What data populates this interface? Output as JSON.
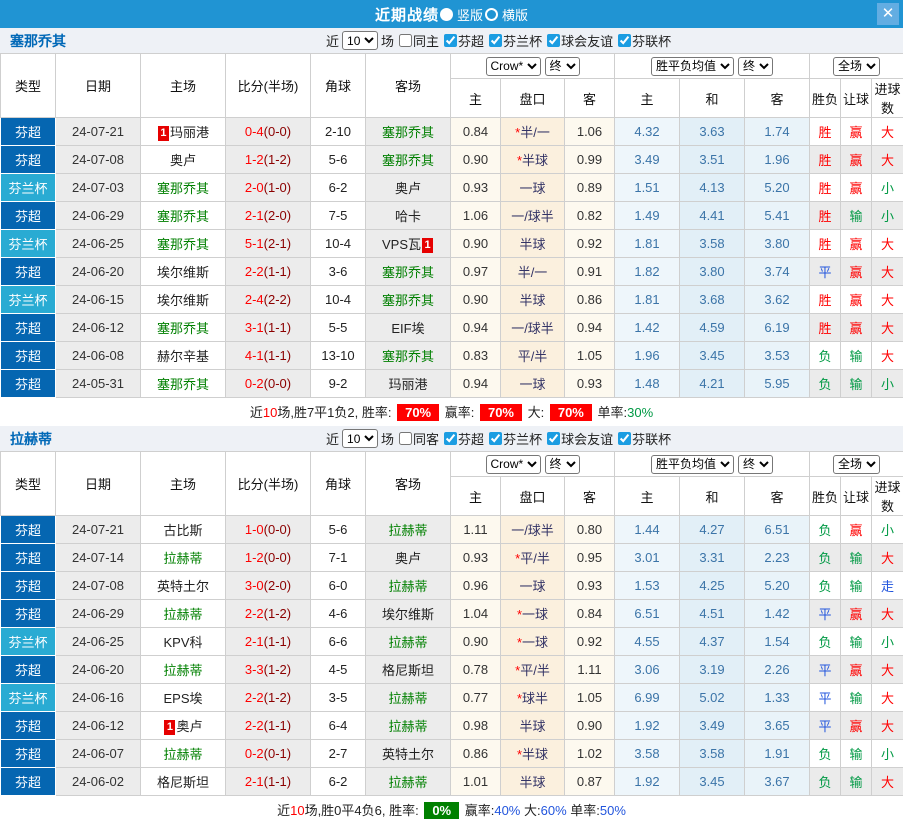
{
  "titlebar": {
    "title": "近期战绩",
    "vertical_label": "竖版",
    "horizontal_label": "横版",
    "close_label": "✕",
    "bar_color": "#2094d3"
  },
  "table_header": {
    "static_cols": [
      "类型",
      "日期",
      "主场",
      "比分(半场)",
      "角球",
      "客场"
    ],
    "sub_cols": [
      "主",
      "盘口",
      "客",
      "主",
      "和",
      "客",
      "胜负",
      "让球",
      "进球数"
    ],
    "selects": {
      "company": "Crow*",
      "company_final": "终",
      "avg": "胜平负均值",
      "avg_final": "终",
      "scope": "全场"
    }
  },
  "strings": {
    "card_label": "1"
  },
  "colors": {
    "league_super": "#0566b1",
    "league_cup": "#29abd3",
    "win": "#e60000",
    "draw": "#0000dd",
    "lose": "#008000"
  },
  "sections": [
    {
      "team": "塞那乔其",
      "filter": {
        "near": "近",
        "count": "10",
        "games": "场",
        "same": "同主",
        "leagues": [
          "芬超",
          "芬兰杯",
          "球会友谊",
          "芬联杯"
        ]
      },
      "rows": [
        {
          "type": "芬超",
          "cup": false,
          "date": "24-07-21",
          "home": {
            "name": "玛丽港",
            "green": false,
            "card": "before"
          },
          "score": "0-4",
          "half": "(0-0)",
          "corner": "2-10",
          "away": {
            "name": "塞那乔其",
            "green": true
          },
          "odds": [
            "0.84",
            "*半/一",
            "1.06"
          ],
          "avg": [
            "4.32",
            "3.63",
            "1.74"
          ],
          "res": [
            "胜",
            "赢",
            "大"
          ]
        },
        {
          "type": "芬超",
          "cup": false,
          "date": "24-07-08",
          "home": {
            "name": "奥卢",
            "green": false
          },
          "score": "1-2",
          "half": "(1-2)",
          "corner": "5-6",
          "away": {
            "name": "塞那乔其",
            "green": true
          },
          "odds": [
            "0.90",
            "*半球",
            "0.99"
          ],
          "avg": [
            "3.49",
            "3.51",
            "1.96"
          ],
          "res": [
            "胜",
            "赢",
            "大"
          ]
        },
        {
          "type": "芬兰杯",
          "cup": true,
          "date": "24-07-03",
          "home": {
            "name": "塞那乔其",
            "green": true
          },
          "score": "2-0",
          "half": "(1-0)",
          "corner": "6-2",
          "away": {
            "name": "奥卢",
            "green": false
          },
          "odds": [
            "0.93",
            "一球",
            "0.89"
          ],
          "avg": [
            "1.51",
            "4.13",
            "5.20"
          ],
          "res": [
            "胜",
            "赢",
            "小"
          ]
        },
        {
          "type": "芬超",
          "cup": false,
          "date": "24-06-29",
          "home": {
            "name": "塞那乔其",
            "green": true
          },
          "score": "2-1",
          "half": "(2-0)",
          "corner": "7-5",
          "away": {
            "name": "哈卡",
            "green": false
          },
          "odds": [
            "1.06",
            "一/球半",
            "0.82"
          ],
          "avg": [
            "1.49",
            "4.41",
            "5.41"
          ],
          "res": [
            "胜",
            "输",
            "小"
          ]
        },
        {
          "type": "芬兰杯",
          "cup": true,
          "date": "24-06-25",
          "home": {
            "name": "塞那乔其",
            "green": true
          },
          "score": "5-1",
          "half": "(2-1)",
          "corner": "10-4",
          "away": {
            "name": "VPS瓦",
            "green": false,
            "card": "after"
          },
          "odds": [
            "0.90",
            "半球",
            "0.92"
          ],
          "avg": [
            "1.81",
            "3.58",
            "3.80"
          ],
          "res": [
            "胜",
            "赢",
            "大"
          ]
        },
        {
          "type": "芬超",
          "cup": false,
          "date": "24-06-20",
          "home": {
            "name": "埃尔维斯",
            "green": false
          },
          "score": "2-2",
          "half": "(1-1)",
          "corner": "3-6",
          "away": {
            "name": "塞那乔其",
            "green": true
          },
          "odds": [
            "0.97",
            "半/一",
            "0.91"
          ],
          "avg": [
            "1.82",
            "3.80",
            "3.74"
          ],
          "res": [
            "平",
            "赢",
            "大"
          ]
        },
        {
          "type": "芬兰杯",
          "cup": true,
          "date": "24-06-15",
          "home": {
            "name": "埃尔维斯",
            "green": false
          },
          "score": "2-4",
          "half": "(2-2)",
          "corner": "10-4",
          "away": {
            "name": "塞那乔其",
            "green": true
          },
          "odds": [
            "0.90",
            "半球",
            "0.86"
          ],
          "avg": [
            "1.81",
            "3.68",
            "3.62"
          ],
          "res": [
            "胜",
            "赢",
            "大"
          ]
        },
        {
          "type": "芬超",
          "cup": false,
          "date": "24-06-12",
          "home": {
            "name": "塞那乔其",
            "green": true
          },
          "score": "3-1",
          "half": "(1-1)",
          "corner": "5-5",
          "away": {
            "name": "EIF埃",
            "green": false
          },
          "odds": [
            "0.94",
            "一/球半",
            "0.94"
          ],
          "avg": [
            "1.42",
            "4.59",
            "6.19"
          ],
          "res": [
            "胜",
            "赢",
            "大"
          ]
        },
        {
          "type": "芬超",
          "cup": false,
          "date": "24-06-08",
          "home": {
            "name": "赫尔辛基",
            "green": false
          },
          "score": "4-1",
          "half": "(1-1)",
          "corner": "13-10",
          "away": {
            "name": "塞那乔其",
            "green": true
          },
          "odds": [
            "0.83",
            "平/半",
            "1.05"
          ],
          "avg": [
            "1.96",
            "3.45",
            "3.53"
          ],
          "res": [
            "负",
            "输",
            "大"
          ]
        },
        {
          "type": "芬超",
          "cup": false,
          "date": "24-05-31",
          "home": {
            "name": "塞那乔其",
            "green": true
          },
          "score": "0-2",
          "half": "(0-0)",
          "corner": "9-2",
          "away": {
            "name": "玛丽港",
            "green": false
          },
          "odds": [
            "0.94",
            "一球",
            "0.93"
          ],
          "avg": [
            "1.48",
            "4.21",
            "5.95"
          ],
          "res": [
            "负",
            "输",
            "小"
          ]
        }
      ],
      "summary": [
        {
          "t": "近"
        },
        {
          "t": "10",
          "c": "red"
        },
        {
          "t": "场,胜7平1负2, 胜率: "
        },
        {
          "t": "70%",
          "badge": "red"
        },
        {
          "t": " 赢率: "
        },
        {
          "t": "70%",
          "badge": "red"
        },
        {
          "t": " 大: "
        },
        {
          "t": "70%",
          "badge": "red"
        },
        {
          "t": " 单率:"
        },
        {
          "t": "30%",
          "c": "green"
        }
      ]
    },
    {
      "team": "拉赫蒂",
      "filter": {
        "near": "近",
        "count": "10",
        "games": "场",
        "same": "同客",
        "leagues": [
          "芬超",
          "芬兰杯",
          "球会友谊",
          "芬联杯"
        ]
      },
      "rows": [
        {
          "type": "芬超",
          "cup": false,
          "date": "24-07-21",
          "home": {
            "name": "古比斯",
            "green": false
          },
          "score": "1-0",
          "half": "(0-0)",
          "corner": "5-6",
          "away": {
            "name": "拉赫蒂",
            "green": true
          },
          "odds": [
            "1.11",
            "一/球半",
            "0.80"
          ],
          "avg": [
            "1.44",
            "4.27",
            "6.51"
          ],
          "res": [
            "负",
            "赢",
            "小"
          ]
        },
        {
          "type": "芬超",
          "cup": false,
          "date": "24-07-14",
          "home": {
            "name": "拉赫蒂",
            "green": true
          },
          "score": "1-2",
          "half": "(0-0)",
          "corner": "7-1",
          "away": {
            "name": "奥卢",
            "green": false
          },
          "odds": [
            "0.93",
            "*平/半",
            "0.95"
          ],
          "avg": [
            "3.01",
            "3.31",
            "2.23"
          ],
          "res": [
            "负",
            "输",
            "大"
          ]
        },
        {
          "type": "芬超",
          "cup": false,
          "date": "24-07-08",
          "home": {
            "name": "英特土尔",
            "green": false
          },
          "score": "3-0",
          "half": "(2-0)",
          "corner": "6-0",
          "away": {
            "name": "拉赫蒂",
            "green": true
          },
          "odds": [
            "0.96",
            "一球",
            "0.93"
          ],
          "avg": [
            "1.53",
            "4.25",
            "5.20"
          ],
          "res": [
            "负",
            "输",
            "走"
          ]
        },
        {
          "type": "芬超",
          "cup": false,
          "date": "24-06-29",
          "home": {
            "name": "拉赫蒂",
            "green": true
          },
          "score": "2-2",
          "half": "(1-2)",
          "corner": "4-6",
          "away": {
            "name": "埃尔维斯",
            "green": false
          },
          "odds": [
            "1.04",
            "*一球",
            "0.84"
          ],
          "avg": [
            "6.51",
            "4.51",
            "1.42"
          ],
          "res": [
            "平",
            "赢",
            "大"
          ]
        },
        {
          "type": "芬兰杯",
          "cup": true,
          "date": "24-06-25",
          "home": {
            "name": "KPV科",
            "green": false
          },
          "score": "2-1",
          "half": "(1-1)",
          "corner": "6-6",
          "away": {
            "name": "拉赫蒂",
            "green": true
          },
          "odds": [
            "0.90",
            "*一球",
            "0.92"
          ],
          "avg": [
            "4.55",
            "4.37",
            "1.54"
          ],
          "res": [
            "负",
            "输",
            "小"
          ]
        },
        {
          "type": "芬超",
          "cup": false,
          "date": "24-06-20",
          "home": {
            "name": "拉赫蒂",
            "green": true
          },
          "score": "3-3",
          "half": "(1-2)",
          "corner": "4-5",
          "away": {
            "name": "格尼斯坦",
            "green": false
          },
          "odds": [
            "0.78",
            "*平/半",
            "1.11"
          ],
          "avg": [
            "3.06",
            "3.19",
            "2.26"
          ],
          "res": [
            "平",
            "赢",
            "大"
          ]
        },
        {
          "type": "芬兰杯",
          "cup": true,
          "date": "24-06-16",
          "home": {
            "name": "EPS埃",
            "green": false
          },
          "score": "2-2",
          "half": "(1-2)",
          "corner": "3-5",
          "away": {
            "name": "拉赫蒂",
            "green": true
          },
          "odds": [
            "0.77",
            "*球半",
            "1.05"
          ],
          "avg": [
            "6.99",
            "5.02",
            "1.33"
          ],
          "res": [
            "平",
            "输",
            "大"
          ]
        },
        {
          "type": "芬超",
          "cup": false,
          "date": "24-06-12",
          "home": {
            "name": "奥卢",
            "green": false,
            "card": "before"
          },
          "score": "2-2",
          "half": "(1-1)",
          "corner": "6-4",
          "away": {
            "name": "拉赫蒂",
            "green": true
          },
          "odds": [
            "0.98",
            "半球",
            "0.90"
          ],
          "avg": [
            "1.92",
            "3.49",
            "3.65"
          ],
          "res": [
            "平",
            "赢",
            "大"
          ]
        },
        {
          "type": "芬超",
          "cup": false,
          "date": "24-06-07",
          "home": {
            "name": "拉赫蒂",
            "green": true
          },
          "score": "0-2",
          "half": "(0-1)",
          "corner": "2-7",
          "away": {
            "name": "英特土尔",
            "green": false
          },
          "odds": [
            "0.86",
            "*半球",
            "1.02"
          ],
          "avg": [
            "3.58",
            "3.58",
            "1.91"
          ],
          "res": [
            "负",
            "输",
            "小"
          ]
        },
        {
          "type": "芬超",
          "cup": false,
          "date": "24-06-02",
          "home": {
            "name": "格尼斯坦",
            "green": false
          },
          "score": "2-1",
          "half": "(1-1)",
          "corner": "6-2",
          "away": {
            "name": "拉赫蒂",
            "green": true
          },
          "odds": [
            "1.01",
            "半球",
            "0.87"
          ],
          "avg": [
            "1.92",
            "3.45",
            "3.67"
          ],
          "res": [
            "负",
            "输",
            "大"
          ]
        }
      ],
      "summary": [
        {
          "t": "近"
        },
        {
          "t": "10",
          "c": "red"
        },
        {
          "t": "场,胜0平4负6, 胜率: "
        },
        {
          "t": "0%",
          "badge": "green"
        },
        {
          "t": " 赢率:"
        },
        {
          "t": "40%",
          "c": "blue"
        },
        {
          "t": " 大:"
        },
        {
          "t": "60%",
          "c": "blue"
        },
        {
          "t": " 单率:"
        },
        {
          "t": "50%",
          "c": "blue"
        }
      ]
    }
  ]
}
